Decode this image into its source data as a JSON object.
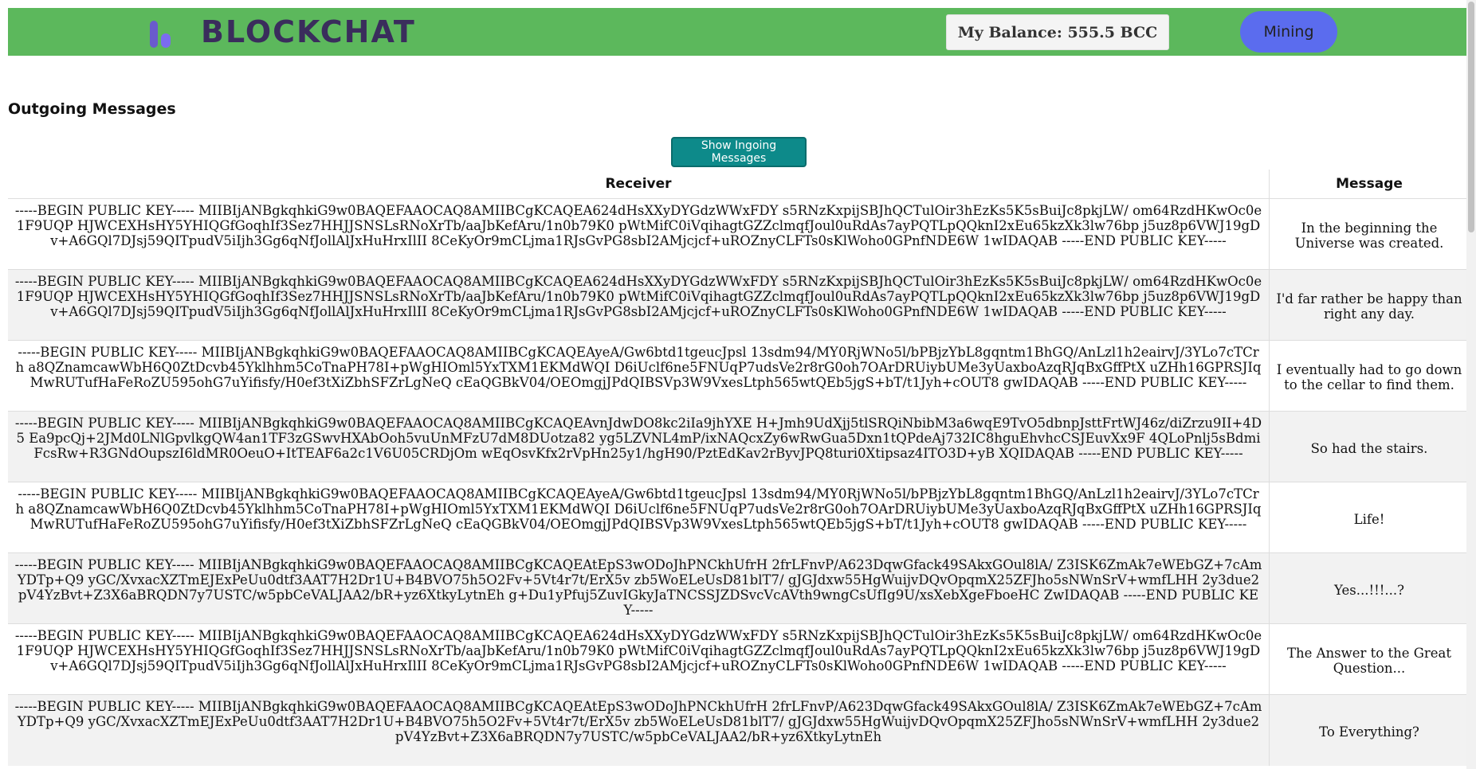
{
  "header": {
    "logo_text": "BLOCKCHAT",
    "balance_label": "My Balance: 555.5 BCC",
    "mining_label": "Mining",
    "accent": "#5cb85c"
  },
  "main": {
    "title": "Outgoing Messages",
    "toggle_label": "Show Ingoing Messages",
    "columns": {
      "receiver": "Receiver",
      "message": "Message"
    },
    "rows": [
      {
        "receiver": "-----BEGIN PUBLIC KEY----- MIIBIjANBgkqhkiG9w0BAQEFAAOCAQ8AMIIBCgKCAQEA624dHsXXyDYGdzWWxFDY s5RNzKxpijSBJhQCTulOir3hEzKs5K5sBuiJc8pkjLW/ om64RzdHKwOc0e1F9UQP HJWCEXHsHY5YHIQGfGoqhIf3Sez7HHJJSNSLsRNoXrTb/aaJbKefAru/1n0b79K0 pWtMifC0iVqihagtGZZclmqfJoul0uRdAs7ayPQTLpQQknI2xEu65kzXk3lw76bp j5uz8p6VWJ19gDv+A6GQl7DJsj59QITpudV5iIjh3Gg6qNfJollAlJxHuHrxIlII 8CeKyOr9mCLjma1RJsGvPG8sbI2AMjcjcf+uROZnyCLFTs0sKlWoho0GPnfNDE6W 1wIDAQAB -----END PUBLIC KEY-----",
        "message": "In the beginning the Universe was created."
      },
      {
        "receiver": "-----BEGIN PUBLIC KEY----- MIIBIjANBgkqhkiG9w0BAQEFAAOCAQ8AMIIBCgKCAQEA624dHsXXyDYGdzWWxFDY s5RNzKxpijSBJhQCTulOir3hEzKs5K5sBuiJc8pkjLW/ om64RzdHKwOc0e1F9UQP HJWCEXHsHY5YHIQGfGoqhIf3Sez7HHJJSNSLsRNoXrTb/aaJbKefAru/1n0b79K0 pWtMifC0iVqihagtGZZclmqfJoul0uRdAs7ayPQTLpQQknI2xEu65kzXk3lw76bp j5uz8p6VWJ19gDv+A6GQl7DJsj59QITpudV5iIjh3Gg6qNfJollAlJxHuHrxIlII 8CeKyOr9mCLjma1RJsGvPG8sbI2AMjcjcf+uROZnyCLFTs0sKlWoho0GPnfNDE6W 1wIDAQAB -----END PUBLIC KEY-----",
        "message": "I'd far rather be happy than right any day."
      },
      {
        "receiver": "-----BEGIN PUBLIC KEY----- MIIBIjANBgkqhkiG9w0BAQEFAAOCAQ8AMIIBCgKCAQEAyeA/Gw6btd1tgeucJpsl 13sdm94/MY0RjWNo5l/bPBjzYbL8gqntm1BhGQ/AnLzl1h2eairvJ/3YLo7cTCrh a8QZnamcawWbH6Q0ZtDcvb45Yklhhm5CoTnaPH78I+pWgHIOml5YxTXM1EKMdWQI D6iUclf6ne5FNUqP7udsVe2r8rG0oh7OArDRUiybUMe3yUaxboAzqRJqBxGffPtX uZHh16GPRSJIqMwRUTufHaFeRoZU595ohG7uYifisfy/H0ef3tXiZbhSFZrLgNeQ cEaQGBkV04/OEOmgjJPdQIBSVp3W9VxesLtph565wtQEb5jgS+bT/t1Jyh+cOUT8 gwIDAQAB -----END PUBLIC KEY-----",
        "message": "I eventually had to go down to the cellar to find them."
      },
      {
        "receiver": "-----BEGIN PUBLIC KEY----- MIIBIjANBgkqhkiG9w0BAQEFAAOCAQ8AMIIBCgKCAQEAvnJdwDO8kc2iIa9jhYXE H+Jmh9UdXjj5tlSRQiNbibM3a6wqE9TvO5dbnpJsttFrtWJ46z/diZrzu9II+4D5 Ea9pcQj+2JMd0LNlGpvlkgQW4an1TF3zGSwvHXAbOoh5vuUnMFzU7dM8DUotza82 yg5LZVNL4mP/ixNAQcxZy6wRwGua5Dxn1tQPdeAj732IC8hguEhvhcCSJEuvXx9F 4QLoPnlj5sBdmiFcsRw+R3GNdOupszI6ldMR0OeuO+ItTEAF6a2c1V6U05CRDjOm wEqOsvKfx2rVpHn25y1/hgH90/PztEdKav2rByvJPQ8turi0Xtipsaz4ITO3D+yB XQIDAQAB -----END PUBLIC KEY-----",
        "message": "So had the stairs."
      },
      {
        "receiver": "-----BEGIN PUBLIC KEY----- MIIBIjANBgkqhkiG9w0BAQEFAAOCAQ8AMIIBCgKCAQEAyeA/Gw6btd1tgeucJpsl 13sdm94/MY0RjWNo5l/bPBjzYbL8gqntm1BhGQ/AnLzl1h2eairvJ/3YLo7cTCrh a8QZnamcawWbH6Q0ZtDcvb45Yklhhm5CoTnaPH78I+pWgHIOml5YxTXM1EKMdWQI D6iUclf6ne5FNUqP7udsVe2r8rG0oh7OArDRUiybUMe3yUaxboAzqRJqBxGffPtX uZHh16GPRSJIqMwRUTufHaFeRoZU595ohG7uYifisfy/H0ef3tXiZbhSFZrLgNeQ cEaQGBkV04/OEOmgjJPdQIBSVp3W9VxesLtph565wtQEb5jgS+bT/t1Jyh+cOUT8 gwIDAQAB -----END PUBLIC KEY-----",
        "message": "Life!"
      },
      {
        "receiver": "-----BEGIN PUBLIC KEY----- MIIBIjANBgkqhkiG9w0BAQEFAAOCAQ8AMIIBCgKCAQEAtEpS3wODoJhPNCkhUfrH 2frLFnvP/A623DqwGfack49SAkxGOul8lA/ Z3ISK6ZmAk7eWEbGZ+7cAmYDTp+Q9 yGC/XvxacXZTmEJExPeUu0dtf3AAT7H2Dr1U+B4BVO75h5O2Fv+5Vt4r7t/ErX5v zb5WoELeUsD81blT7/ gJGJdxw55HgWuijvDQvOpqmX25ZFJho5sNWnSrV+wmfLHH 2y3due2pV4YzBvt+Z3X6aBRQDN7y7USTC/w5pbCeVALJAA2/bR+yz6XtkyLytnEh g+Du1yPfuj5ZuvIGkyJaTNCSSJZDSvcVcAVth9wngCsUfIg9U/xsXebXgeFboeHC ZwIDAQAB -----END PUBLIC KEY-----",
        "message": "Yes...!!!...?"
      },
      {
        "receiver": "-----BEGIN PUBLIC KEY----- MIIBIjANBgkqhkiG9w0BAQEFAAOCAQ8AMIIBCgKCAQEA624dHsXXyDYGdzWWxFDY s5RNzKxpijSBJhQCTulOir3hEzKs5K5sBuiJc8pkjLW/ om64RzdHKwOc0e1F9UQP HJWCEXHsHY5YHIQGfGoqhIf3Sez7HHJJSNSLsRNoXrTb/aaJbKefAru/1n0b79K0 pWtMifC0iVqihagtGZZclmqfJoul0uRdAs7ayPQTLpQQknI2xEu65kzXk3lw76bp j5uz8p6VWJ19gDv+A6GQl7DJsj59QITpudV5iIjh3Gg6qNfJollAlJxHuHrxIlII 8CeKyOr9mCLjma1RJsGvPG8sbI2AMjcjcf+uROZnyCLFTs0sKlWoho0GPnfNDE6W 1wIDAQAB -----END PUBLIC KEY-----",
        "message": "The Answer to the Great Question..."
      },
      {
        "receiver": "-----BEGIN PUBLIC KEY----- MIIBIjANBgkqhkiG9w0BAQEFAAOCAQ8AMIIBCgKCAQEAtEpS3wODoJhPNCkhUfrH 2frLFnvP/A623DqwGfack49SAkxGOul8lA/ Z3ISK6ZmAk7eWEbGZ+7cAmYDTp+Q9 yGC/XvxacXZTmEJExPeUu0dtf3AAT7H2Dr1U+B4BVO75h5O2Fv+5Vt4r7t/ErX5v zb5WoELeUsD81blT7/ gJGJdxw55HgWuijvDQvOpqmX25ZFJho5sNWnSrV+wmfLHH 2y3due2pV4YzBvt+Z3X6aBRQDN7y7USTC/w5pbCeVALJAA2/bR+yz6XtkyLytnEh",
        "message": "To Everything?"
      }
    ]
  }
}
